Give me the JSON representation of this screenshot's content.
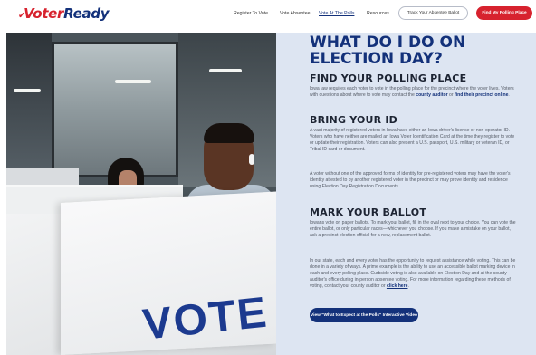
{
  "brand": {
    "voter": "Voter",
    "ready": "Ready"
  },
  "nav": {
    "items": [
      {
        "label": "Register To Vote"
      },
      {
        "label": "Vote Absentee"
      },
      {
        "label": "Vote At The Polls"
      },
      {
        "label": "Resources"
      }
    ],
    "active_index": 2,
    "track_button": "Track Your Absentee Ballot",
    "find_button": "Find My Polling Place"
  },
  "hero_image": {
    "booth_text": "VOTE"
  },
  "main": {
    "title": "WHAT DO I DO ON ELECTION DAY?",
    "sections": [
      {
        "heading": "FIND YOUR POLLING PLACE",
        "paragraph": {
          "text_before": "Iowa law requires each voter to vote in the polling place for the precinct where the voter lives. Voters with questions about where to vote may contact the ",
          "link1": "county auditor",
          "text_middle": " or ",
          "link2": "find their precinct online",
          "text_after": "."
        }
      },
      {
        "heading": "BRING YOUR ID",
        "paragraphs": [
          "A vast majority of registered voters in Iowa have either an Iowa driver's license or non-operator ID. Voters who have neither are mailed an Iowa Voter Identification Card at the time they register to vote or update their registration. Voters can also present a U.S. passport, U.S. military or veteran ID, or Tribal ID card or document.",
          "A voter without one of the approved forms of identity for pre-registered voters may have the voter's identity attested to by another registered voter in the precinct or may prove identity and residence using Election Day Registration Documents."
        ]
      },
      {
        "heading": "MARK YOUR BALLOT",
        "paragraphs": [
          "Iowans vote on paper ballots. To mark your ballot, fill in the oval next to your choice. You can vote the entire ballot, or only particular races—whichever you choose. If you make a mistake on your ballot, ask a precinct election official for a new, replacement ballot."
        ],
        "last_paragraph": {
          "text_before": "In our state, each and every voter has the opportunity to request assistance while voting. This can be done in a variety of ways. A prime example is the ability to use an accessible ballot marking device in each and every polling place. Curbside voting is also available on Election Day and at the county auditor's office during in-person absentee voting. For more information regarding these methods of voting, contact your county auditor or ",
          "link": "click here",
          "text_after": "."
        }
      }
    ],
    "video_button": "View \"What to Expect at the Polls\" Interactive Video"
  },
  "colors": {
    "brand_red": "#d7222e",
    "brand_navy": "#13317a",
    "content_bg": "#dde5f2"
  }
}
